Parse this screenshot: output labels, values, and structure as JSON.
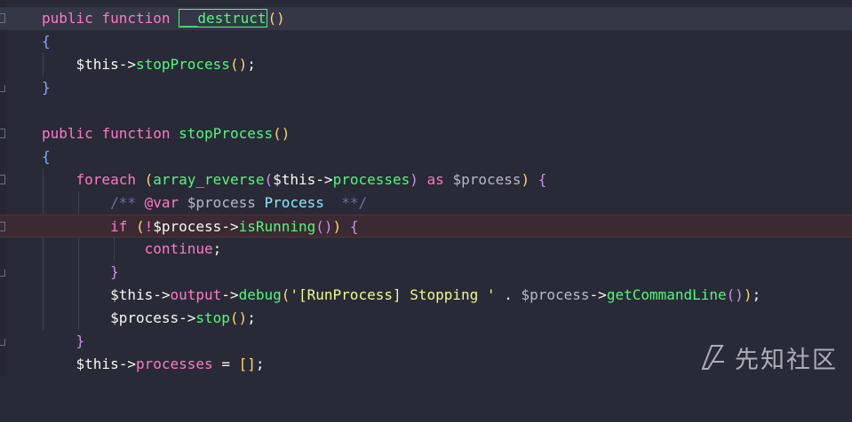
{
  "editor": {
    "lines": {
      "l1": {
        "kw1": "public",
        "kw2": "function",
        "name": "__destruct",
        "parens": "()"
      },
      "l2": {
        "text": "{"
      },
      "l3": {
        "var": "$this",
        "arrow": "->",
        "call": "stopProcess",
        "parens": "()",
        "semi": ";"
      },
      "l4": {
        "text": "}"
      },
      "l6": {
        "kw1": "public",
        "kw2": "function",
        "name": "stopProcess",
        "parens": "()"
      },
      "l7": {
        "text": "{"
      },
      "l8": {
        "kw": "foreach",
        "open": "(",
        "fn": "array_reverse",
        "p1": "(",
        "var": "$this",
        "arrow": "->",
        "prop": "processes",
        "p2": ")",
        "as": "as",
        "var2": "$process",
        "close": ")",
        "brace": "{"
      },
      "l9": {
        "open": "/**",
        "tag": "@var",
        "var": "$process",
        "type": "Process",
        "close": "**/"
      },
      "l10": {
        "kw": "if",
        "open": "(",
        "neg": "!",
        "var": "$process",
        "arrow": "->",
        "call": "isRunning",
        "parens": "()",
        "close": ")",
        "brace": "{"
      },
      "l11": {
        "kw": "continue",
        "semi": ";"
      },
      "l12": {
        "text": "}"
      },
      "l13": {
        "var": "$this",
        "a1": "->",
        "prop": "output",
        "a2": "->",
        "call": "debug",
        "p1": "(",
        "str": "'[RunProcess] Stopping '",
        "dot": ".",
        "var2": "$process",
        "a3": "->",
        "call2": "getCommandLine",
        "p2": "()",
        "p3": ")",
        "semi": ";"
      },
      "l14": {
        "var": "$process",
        "arrow": "->",
        "call": "stop",
        "parens": "()",
        "semi": ";"
      },
      "l15": {
        "text": "}"
      },
      "l16": {
        "var": "$this",
        "arrow": "->",
        "prop": "processes",
        "eq": "=",
        "arr": "[]",
        "semi": ";"
      }
    }
  },
  "watermark": {
    "text": "先知社区",
    "icon": "xianzhi-logo-icon"
  }
}
